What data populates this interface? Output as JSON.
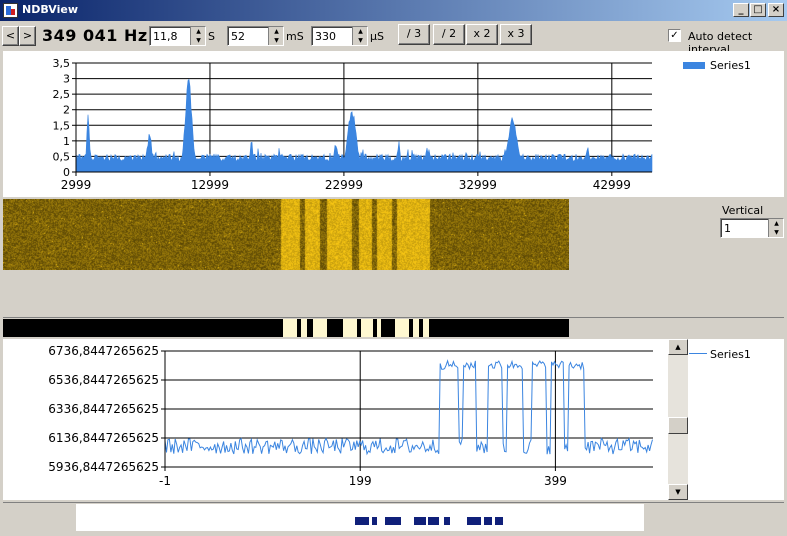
{
  "window": {
    "title": "NDBView",
    "minimize_glyph": "_",
    "maximize_glyph": "□",
    "close_glyph": "×"
  },
  "toolbar": {
    "prev_glyph": "<",
    "next_glyph": ">",
    "frequency": "349 041 Hz",
    "seconds_value": "11,8",
    "seconds_unit": "S",
    "ms_value": "52",
    "ms_unit": "mS",
    "us_value": "330",
    "us_unit": "µS",
    "div3_label": "/ 3",
    "div2_label": "/ 2",
    "mul2_label": "x 2",
    "mul3_label": "x 3",
    "auto_detect_label": "Auto detect interval",
    "auto_detect_checked": true,
    "check_glyph": "✓"
  },
  "vertical_zoom": {
    "label": "Vertical zoom",
    "value": "1"
  },
  "icons": [
    "app-icon",
    "chevron-left-icon",
    "chevron-right-icon",
    "spin-up-icon",
    "spin-down-icon",
    "scroll-up-icon",
    "scroll-down-icon"
  ],
  "colors": {
    "series": "#3b85e0",
    "morse_mark": "#fff8d0",
    "code_mark": "#10207a",
    "title_start": "#0a246a",
    "title_end": "#a6caf0"
  },
  "chart_data": [
    {
      "type": "area",
      "title": "",
      "legend": {
        "entries": [
          "Series1"
        ],
        "position": "top-right"
      },
      "xlim": [
        2999,
        45999
      ],
      "ylim": [
        0,
        3.5
      ],
      "x_ticks": [
        2999,
        12999,
        22999,
        32999,
        42999
      ],
      "x_tick_labels": [
        "2999",
        "12999",
        "22999",
        "32999",
        "42999"
      ],
      "y_ticks": [
        0,
        0.5,
        1,
        1.5,
        2,
        2.5,
        3,
        3.5
      ],
      "y_tick_labels": [
        "0",
        "0,5",
        "1",
        "1,5",
        "2",
        "2,5",
        "3",
        "3,5"
      ],
      "grid": true,
      "baseline": 0.5,
      "peaks": [
        {
          "x": 3900,
          "y": 1.85,
          "width": 150
        },
        {
          "x": 8500,
          "y": 1.35,
          "width": 200
        },
        {
          "x": 11400,
          "y": 3.1,
          "width": 350
        },
        {
          "x": 16100,
          "y": 1.05,
          "width": 150
        },
        {
          "x": 22400,
          "y": 0.95,
          "width": 220
        },
        {
          "x": 23600,
          "y": 2.05,
          "width": 450
        },
        {
          "x": 27100,
          "y": 1.0,
          "width": 150
        },
        {
          "x": 29200,
          "y": 0.85,
          "width": 150
        },
        {
          "x": 35600,
          "y": 1.75,
          "width": 500
        },
        {
          "x": 41200,
          "y": 0.85,
          "width": 150
        }
      ]
    },
    {
      "type": "line",
      "title": "",
      "legend": {
        "entries": [
          "Series1"
        ],
        "position": "top-right"
      },
      "xlim": [
        -1,
        499
      ],
      "ylim": [
        5936.8447265625,
        6736.8447265625
      ],
      "x_ticks": [
        -1,
        199,
        399
      ],
      "x_tick_labels": [
        "-1",
        "199",
        "399"
      ],
      "y_ticks": [
        5936.8447265625,
        6136.8447265625,
        6336.8447265625,
        6536.8447265625,
        6736.8447265625
      ],
      "y_tick_labels": [
        "5936,8447265625",
        "6136,8447265625",
        "6336,8447265625",
        "6536,8447265625",
        "6736,8447265625"
      ],
      "grid": true,
      "low_level": 6080,
      "high_level": 6640,
      "high_segments": [
        [
          280,
          300
        ],
        [
          305,
          318
        ],
        [
          330,
          344
        ],
        [
          350,
          365
        ],
        [
          375,
          390
        ],
        [
          395,
          407
        ],
        [
          412,
          428
        ]
      ]
    }
  ]
}
